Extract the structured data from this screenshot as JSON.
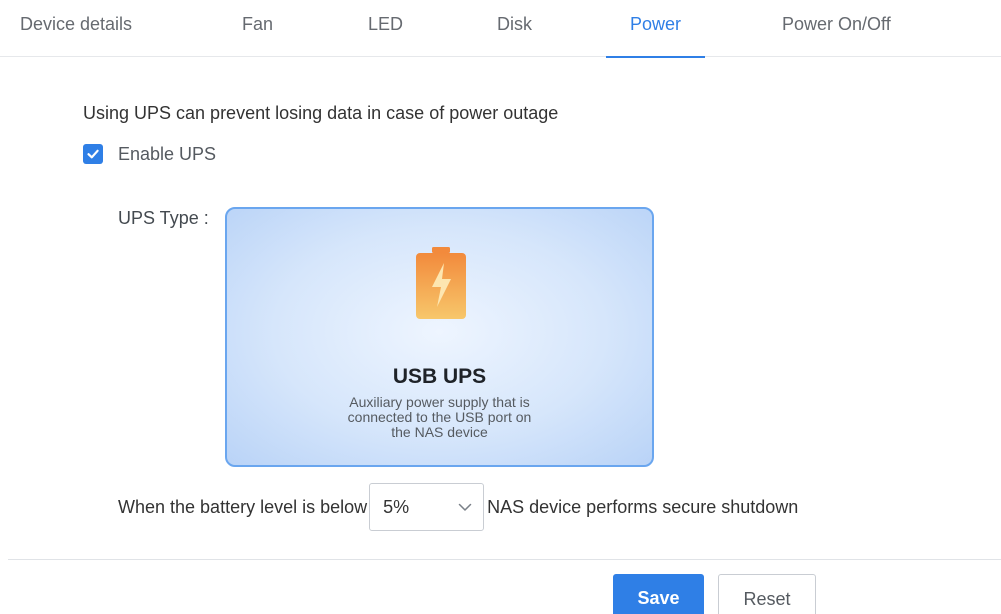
{
  "tabs": [
    {
      "label": "Device details",
      "active": false
    },
    {
      "label": "Fan",
      "active": false
    },
    {
      "label": "LED",
      "active": false
    },
    {
      "label": "Disk",
      "active": false
    },
    {
      "label": "Power",
      "active": true
    },
    {
      "label": "Power On/Off",
      "active": false
    }
  ],
  "power": {
    "intro_text": "Using UPS can prevent losing data in case of power outage",
    "enable_ups": {
      "label": "Enable UPS",
      "checked": true
    },
    "ups_type_label": "UPS Type :",
    "ups_card": {
      "icon": "battery-charging-icon",
      "title": "USB UPS",
      "description_lines": [
        "Auxiliary power supply that is",
        "connected to the USB port on",
        "the NAS device"
      ],
      "selected": true
    },
    "threshold": {
      "prefix": "When the battery level is below",
      "selected_value": "5%",
      "suffix": "NAS device performs secure shutdown"
    }
  },
  "footer": {
    "save_label": "Save",
    "reset_label": "Reset"
  },
  "colors": {
    "accent": "#2f7fe6",
    "card_border": "#6aa6ef",
    "battery_top": "#f28a3c",
    "battery_bottom": "#f7c76b"
  }
}
